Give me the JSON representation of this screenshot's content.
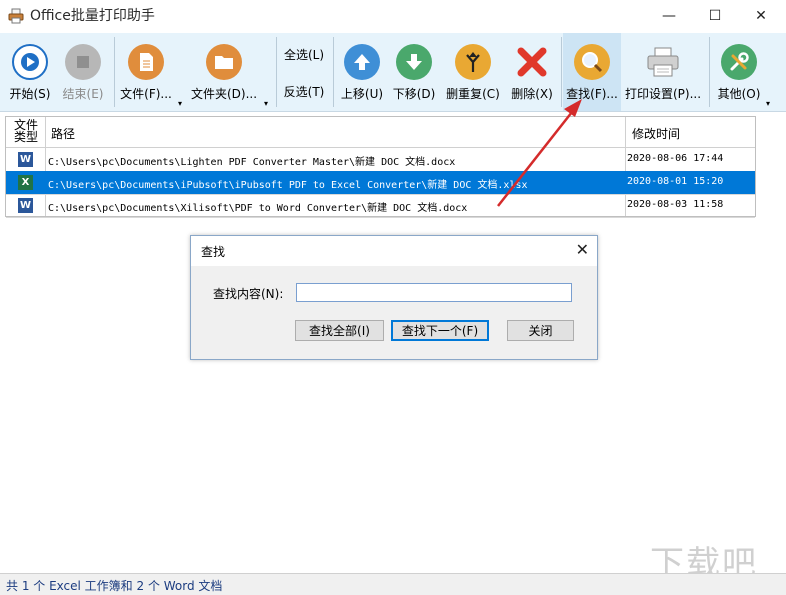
{
  "window": {
    "title": "Office批量打印助手",
    "minimize": "—",
    "maximize": "☐",
    "close": "✕"
  },
  "toolbar": {
    "start": "开始(S)",
    "stop": "结束(E)",
    "file": "文件(F)...",
    "folder": "文件夹(D)...",
    "select_all": "全选(L)",
    "invert": "反选(T)",
    "move_up": "上移(U)",
    "move_down": "下移(D)",
    "dedupe": "删重复(C)",
    "delete": "删除(X)",
    "find": "查找(F)...",
    "print_settings": "打印设置(P)...",
    "other": "其他(O)",
    "dropdown_glyph": "▾"
  },
  "grid": {
    "columns": [
      "文件类型",
      "路径",
      "修改时间"
    ],
    "rows": [
      {
        "type": "W",
        "type_color": "#2b579a",
        "path": "C:\\Users\\pc\\Documents\\Lighten PDF Converter Master\\新建 DOC 文档.docx",
        "time": "2020-08-06 17:44"
      },
      {
        "type": "X",
        "type_color": "#217346",
        "path": "C:\\Users\\pc\\Documents\\iPubsoft\\iPubsoft PDF to Excel Converter\\新建 DOC 文档.xlsx",
        "time": "2020-08-01 15:20"
      },
      {
        "type": "W",
        "type_color": "#2b579a",
        "path": "C:\\Users\\pc\\Documents\\Xilisoft\\PDF to Word Converter\\新建 DOC 文档.docx",
        "time": "2020-08-03 11:58"
      }
    ]
  },
  "dialog": {
    "title": "查找",
    "close": "✕",
    "label": "查找内容(N):",
    "input_value": "",
    "find_all": "查找全部(I)",
    "find_next": "查找下一个(F)",
    "close_btn": "关闭"
  },
  "status": {
    "text": "共 1 个 Excel 工作簿和 2 个 Word 文档"
  },
  "watermark": "下载吧",
  "colors": {
    "accent": "#0078d7",
    "arrow": "#d42b2b"
  }
}
